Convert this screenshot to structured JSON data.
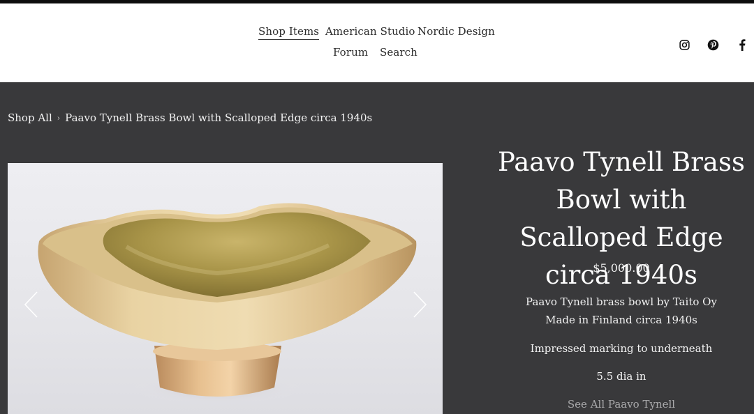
{
  "nav": {
    "items": [
      {
        "label": "Shop Items",
        "active": true
      },
      {
        "label": "American Studio"
      },
      {
        "label": "Nordic Design"
      },
      {
        "label": "Forum"
      },
      {
        "label": "Search"
      }
    ]
  },
  "social": {
    "icons": [
      "instagram-icon",
      "pinterest-icon",
      "facebook-icon"
    ]
  },
  "breadcrumb": {
    "root": "Shop All",
    "separator": "›",
    "current": "Paavo Tynell Brass Bowl with Scalloped Edge circa 1940s"
  },
  "product": {
    "title": "Paavo Tynell Brass Bowl with Scalloped Edge circa 1940s",
    "price": "$5,000.00",
    "description_line1": "Paavo Tynell brass bowl by Taito Oy",
    "description_line2": "Made in Finland circa 1940s",
    "marking": "Impressed marking to underneath",
    "dimensions": "5.5 dia in",
    "see_all": "See All Paavo Tynell"
  },
  "gallery": {
    "prev_icon": "chevron-left-icon",
    "next_icon": "chevron-right-icon"
  },
  "colors": {
    "background_dark": "#39393b",
    "header_bg": "#ffffff",
    "text_light": "#f2f2f2",
    "link_muted": "#a9a9ab"
  }
}
